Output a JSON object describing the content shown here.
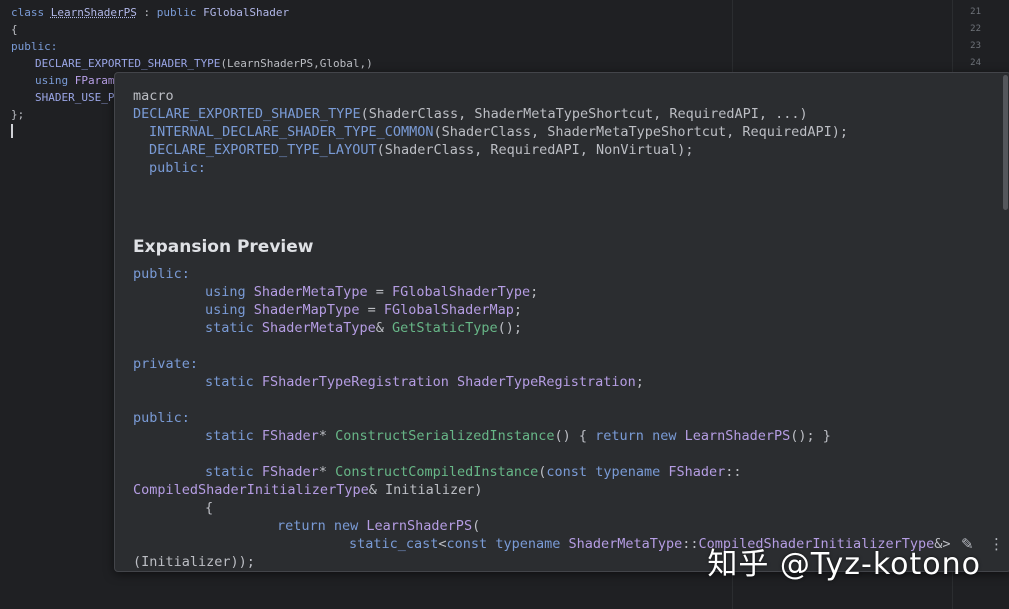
{
  "editor": {
    "line1": {
      "a": "class ",
      "b": "LearnShaderPS",
      "c": " : ",
      "d": "public ",
      "e": "FGlobalShader"
    },
    "line2": "{",
    "line3": "public:",
    "line4": {
      "a": "DECLARE_EXPORTED_SHADER_TYPE",
      "b": "(LearnShaderPS,Global,)"
    },
    "line5": {
      "a": "using ",
      "b": "FParame"
    },
    "line6": "SHADER_USE_PA",
    "line7": "};"
  },
  "gutter": [
    "21",
    "22",
    "23",
    "24"
  ],
  "popup": {
    "kind": "macro",
    "sig_name": "DECLARE_EXPORTED_SHADER_TYPE",
    "sig_args": "(ShaderClass, ShaderMetaTypeShortcut, RequiredAPI, ...)",
    "body1_name": "INTERNAL_DECLARE_SHADER_TYPE_COMMON",
    "body1_args": "(ShaderClass, ShaderMetaTypeShortcut, RequiredAPI);",
    "body2_name": "DECLARE_EXPORTED_TYPE_LAYOUT",
    "body2_args": "(ShaderClass, RequiredAPI, NonVirtual);",
    "body3": "public:",
    "expansion_title": "Expansion Preview",
    "e1": "public:",
    "e2": {
      "a": "using ",
      "b": "ShaderMetaType",
      "c": " = ",
      "d": "FGlobalShaderType",
      ";": ";"
    },
    "e3": {
      "a": "using ",
      "b": "ShaderMapType",
      "c": " = ",
      "d": "FGlobalShaderMap",
      "e": ";"
    },
    "e4": {
      "a": "static ",
      "b": "ShaderMetaType",
      "c": "& ",
      "d": "GetStaticType",
      "e": "();"
    },
    "e5": "private:",
    "e6": {
      "a": "static ",
      "b": "FShaderTypeRegistration",
      "c": " ",
      "d": "ShaderTypeRegistration",
      "e": ";"
    },
    "e7": "public:",
    "e8": {
      "a": "static ",
      "b": "FShader",
      "c": "* ",
      "d": "ConstructSerializedInstance",
      "e": "() { ",
      "f": "return new ",
      "g": "LearnShaderPS",
      "h": "(); }"
    },
    "e9": {
      "a": "static ",
      "b": "FShader",
      "c": "* ",
      "d": "ConstructCompiledInstance",
      "e": "(",
      "f": "const typename ",
      "g": "FShader",
      "h": "::"
    },
    "e10": {
      "a": "CompiledShaderInitializerType",
      "b": "& Initializer)"
    },
    "e11": "{",
    "e12": {
      "a": "return new ",
      "b": "LearnShaderPS",
      "c": "("
    },
    "e13": {
      "a": "static_cast",
      "b": "<",
      "c": "const typename ",
      "d": "ShaderMetaType",
      "e": "::",
      "f": "CompiledShaderInitializerType",
      "g": "&>"
    },
    "e14": "(Initializer));"
  },
  "icons": {
    "edit": "pencil-icon",
    "more": "more-vertical-icon"
  },
  "watermark": "知乎 @Tyz-kotono"
}
